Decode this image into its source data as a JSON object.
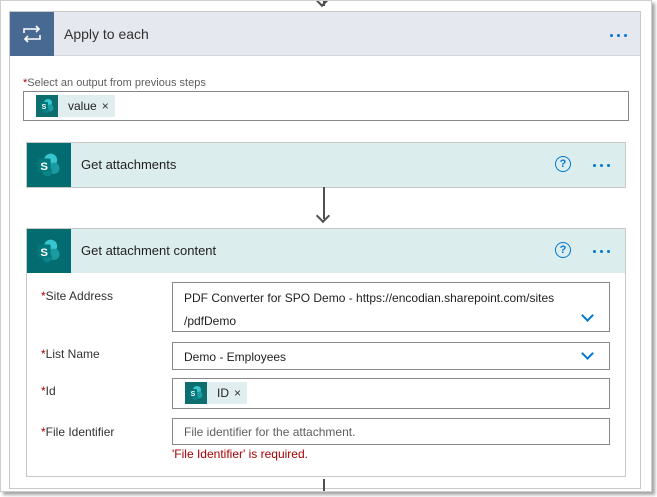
{
  "apply_each": {
    "title": "Apply to each",
    "select_label": "Select an output from previous steps",
    "required_mark": "*",
    "token": {
      "label": "value",
      "remove": "×"
    }
  },
  "get_attachments": {
    "title": "Get attachments",
    "help": "?"
  },
  "get_attachment_content": {
    "title": "Get attachment content",
    "help": "?",
    "fields": {
      "site_address": {
        "label": "Site Address",
        "value_line1": "PDF Converter for SPO Demo - https://encodian.sharepoint.com/sites",
        "value_line2": "/pdfDemo"
      },
      "list_name": {
        "label": "List Name",
        "value": "Demo - Employees"
      },
      "id": {
        "label": "Id",
        "token": "ID",
        "remove": "×"
      },
      "file_identifier": {
        "label": "File Identifier",
        "placeholder": "File identifier for the attachment.",
        "error": "'File Identifier' is required."
      }
    }
  },
  "colors": {
    "loop_icon_bg": "#486991",
    "sharepoint_bg": "#036c70",
    "action_header_bg": "#dcedee",
    "accent": "#0078d4",
    "error": "#a80000"
  },
  "icons": [
    "loop-icon",
    "sharepoint-icon",
    "help-icon",
    "more-options-icon",
    "chevron-down-icon",
    "close-icon",
    "down-arrow-icon"
  ]
}
